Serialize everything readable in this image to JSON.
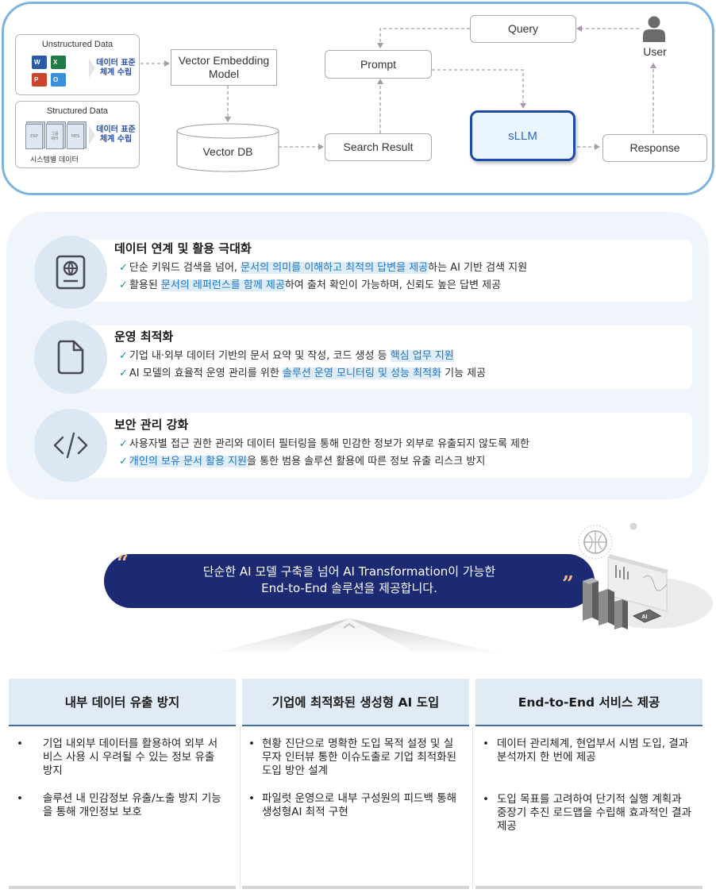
{
  "architecture": {
    "unstructured": {
      "title": "Unstructured Data",
      "file_icons": [
        "word-icon",
        "excel-icon",
        "powerpoint-icon",
        "outlook-icon"
      ],
      "file_icon_letters": [
        "W",
        "X",
        "P",
        "O"
      ],
      "std_label_line1": "데이터 표준",
      "std_label_line2": "체계 수립"
    },
    "structured": {
      "title": "Structured Data",
      "systems": [
        "ERP",
        "그룹\n웨어",
        "MES"
      ],
      "caption": "시스템별 데이터",
      "std_label_line1": "데이터 표준",
      "std_label_line2": "체계 수립"
    },
    "nodes": {
      "embedding_line1": "Vector Embedding",
      "embedding_line2": "Model",
      "vector_db": "Vector DB",
      "search_result": "Search Result",
      "prompt": "Prompt",
      "query": "Query",
      "sllm": "sLLM",
      "response": "Response",
      "user": "User"
    },
    "colors": {
      "frame": "#7fb3df",
      "sllm_border": "#1d4aa6",
      "sllm_fill": "#eaf6fd",
      "arrow": "#a89aab",
      "std_label": "#2a4fa6"
    }
  },
  "features": [
    {
      "icon": "passport-globe-icon",
      "title": "데이터 연계 및 활용 극대화",
      "lines": [
        {
          "pre": "단순 키워드 검색을 넘어, ",
          "hl": "문서의 의미를 이해하고 최적의 답변을 제공",
          "post": "하는 AI 기반 검색 지원"
        },
        {
          "pre": "활용된 ",
          "hl": "문서의 레퍼런스를 함께 제공",
          "post": "하여 출처 확인이 가능하며, 신뢰도 높은 답변 제공"
        }
      ]
    },
    {
      "icon": "document-icon",
      "title": "운영 최적화",
      "lines": [
        {
          "pre": "기업 내·외부 데이터 기반의 문서 요약 및 작성, 코드 생성 등 ",
          "hl": "핵심 업무 지원",
          "post": ""
        },
        {
          "pre": "AI 모델의 효율적 운영 관리를 위한 ",
          "hl": "솔루션 운영 모니터링 및 성능 최적화",
          "post": " 기능 제공"
        }
      ]
    },
    {
      "icon": "code-icon",
      "title": "보안 관리 강화",
      "lines": [
        {
          "pre": "사용자별 접근 권한 관리와 데이터 필터링을 통해 민감한 정보가 외부로 유출되지 않도록 제한",
          "hl": "",
          "post": ""
        },
        {
          "pre": "",
          "hl": "개인의 보유 문서 활용 지원",
          "post": "을 통한 범용 솔루션 활용에 따른 정보 유출 리스크 방지"
        }
      ]
    }
  ],
  "check_mark": "✓",
  "banner": {
    "open_quote": "“",
    "close_quote": "”",
    "line1": "단순한 AI 모델 구축을 넘어 AI Transformation이 가능한",
    "line2": "End-to-End 솔루션을 제공합니다.",
    "illustration": "ai-server-dashboard-illustration",
    "chip_label": "AI",
    "colors": {
      "fill": "#1b2a72",
      "quote": "#f3b88a"
    }
  },
  "columns": [
    {
      "title": "내부 데이터 유출 방지",
      "bullets": [
        "기업 내외부 데이터를 활용하여 외부 서비스 사용 시 우려될 수 있는 정보 유출 방지",
        "솔루션 내 민감정보 유출/노출 방지 기능을 통해 개인정보 보호"
      ]
    },
    {
      "title": "기업에 최적화된 생성형 AI 도입",
      "bullets": [
        "현황 진단으로 명확한 도입 목적 설정 및 실무자 인터뷰 통한 이슈도출로 기업 최적화된 도입 방안 설계",
        "파일럿 운영으로 내부 구성원의 피드백 통해 생성형AI 최적 구현"
      ]
    },
    {
      "title": "End-to-End 서비스 제공",
      "bullets": [
        "데이터 관리체계, 현업부서 시범 도입, 결과 분석까지 한 번에 제공",
        "도입 목표를 고려하여 단기적 실행 계획과 중장기 추진 로드맵을 수립해 효과적인 결과 제공"
      ]
    }
  ],
  "bullet_glyph": "•"
}
